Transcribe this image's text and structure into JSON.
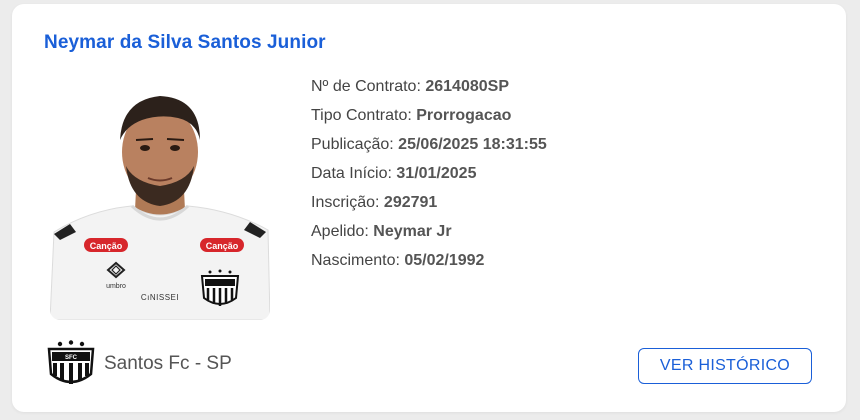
{
  "player": {
    "name": "Neymar da Silva Santos Junior",
    "photo_alt": "Neymar da Silva Santos Junior"
  },
  "details": [
    {
      "label": "Nº de Contrato:",
      "value": "2614080SP"
    },
    {
      "label": "Tipo Contrato:",
      "value": "Prorrogacao"
    },
    {
      "label": "Publicação:",
      "value": "25/06/2025 18:31:55"
    },
    {
      "label": "Data Início:",
      "value": "31/01/2025"
    },
    {
      "label": "Inscrição:",
      "value": "292791"
    },
    {
      "label": "Apelido:",
      "value": "Neymar Jr"
    },
    {
      "label": "Nascimento:",
      "value": "05/02/1992"
    }
  ],
  "jersey_text": {
    "sponsor_left": "Canção",
    "sponsor_right": "Canção",
    "brand": "umbro",
    "back_sponsor": "CıNISSEI"
  },
  "club": {
    "name": "Santos Fc - SP",
    "crest_icon": "santos-crest-icon"
  },
  "actions": {
    "history_label": "VER HISTÓRICO"
  },
  "colors": {
    "accent": "#1a5fd8",
    "card_bg": "#ffffff",
    "page_bg": "#ececec",
    "sponsor_red": "#d7262b"
  }
}
